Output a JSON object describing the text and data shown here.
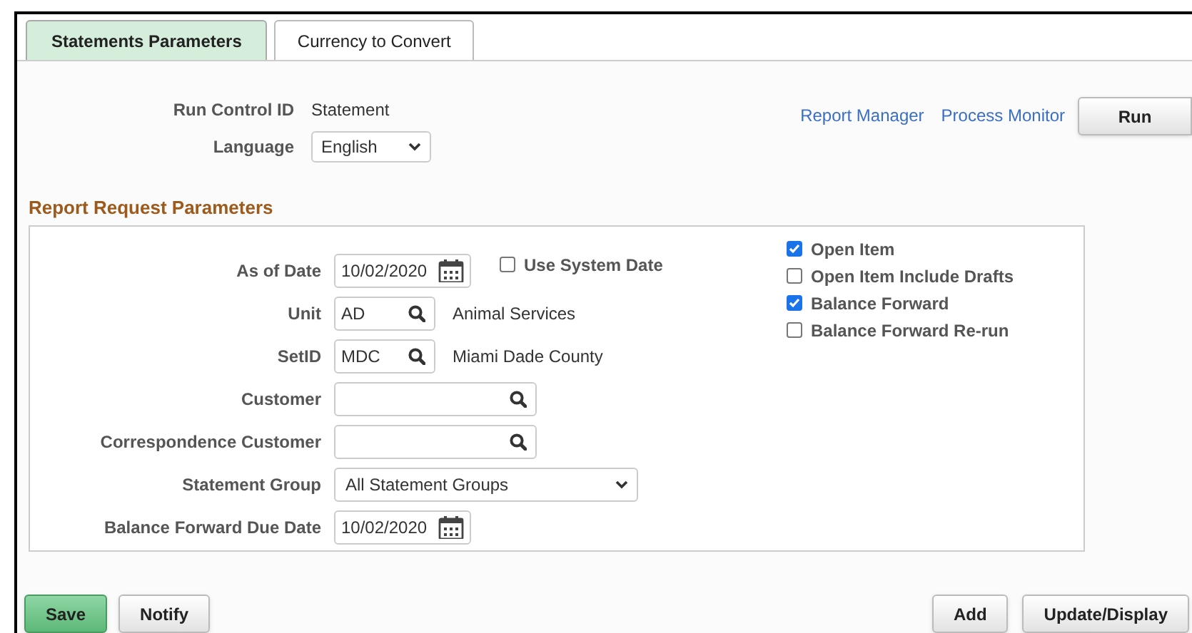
{
  "tabs": [
    {
      "label": "Statements Parameters",
      "selected": true
    },
    {
      "label": "Currency to Convert",
      "selected": false
    }
  ],
  "run_control": {
    "label": "Run Control ID",
    "value": "Statement"
  },
  "language": {
    "label": "Language",
    "value": "English"
  },
  "links": [
    "Report Manager",
    "Process Monitor"
  ],
  "run_button": "Run",
  "section_title": "Report Request Parameters",
  "fields": [
    {
      "kind": "date",
      "label": "As of Date",
      "value": "10/02/2020",
      "checkbox": {
        "label": "Use System Date",
        "checked": false
      }
    },
    {
      "kind": "prompt",
      "label": "Unit",
      "value": "AD",
      "description": "Animal Services"
    },
    {
      "kind": "prompt",
      "label": "SetID",
      "value": "MDC",
      "description": "Miami Dade County"
    },
    {
      "kind": "prompt",
      "label": "Customer"
    },
    {
      "kind": "prompt",
      "label": "Correspondence Customer"
    },
    {
      "kind": "select",
      "label": "Statement Group",
      "value": "All Statement Groups"
    },
    {
      "kind": "date",
      "label": "Balance Forward Due Date",
      "value": "10/02/2020"
    }
  ],
  "options": [
    {
      "label": "Open Item",
      "checked": true
    },
    {
      "label": "Open Item Include Drafts",
      "checked": false
    },
    {
      "label": "Balance Forward",
      "checked": true
    },
    {
      "label": "Balance Forward Re-run",
      "checked": false
    }
  ],
  "buttons_left": [
    {
      "label": "Save",
      "kind": "primary"
    },
    {
      "label": "Notify",
      "kind": "default"
    }
  ],
  "buttons_right": [
    {
      "label": "Add",
      "kind": "default"
    },
    {
      "label": "Update/Display",
      "kind": "default"
    }
  ]
}
